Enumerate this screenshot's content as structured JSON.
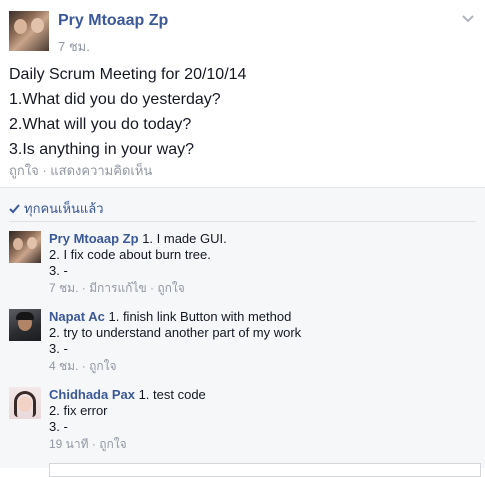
{
  "post": {
    "author": "Pry Mtoaap Zp",
    "time": "7 ชม.",
    "lines": [
      "Daily Scrum Meeting for 20/10/14",
      "1.What did you do yesterday?",
      "2.What will you do today?",
      "3.Is anything in your way?"
    ],
    "actions": {
      "like": "ถูกใจ",
      "separator": " · ",
      "comment": "แสดงความคิดเห็น"
    }
  },
  "feedback": {
    "seen_label": "ทุกคนเห็นแล้ว",
    "comments": [
      {
        "author": "Pry Mtoaap Zp",
        "line1": " 1. I made GUI.",
        "line2": "2. I fix code about burn tree.",
        "line3": "3. -",
        "time": "7 ชม.",
        "edited": "มีการแก้ไข",
        "like": "ถูกใจ"
      },
      {
        "author": "Napat Ac",
        "line1": " 1. finish link Button with method",
        "line2": "2. try to understand another part of my work",
        "line3": "3. -",
        "time": "4 ชม.",
        "like": "ถูกใจ"
      },
      {
        "author": "Chidhada Pax",
        "line1": " 1. test code",
        "line2": "2. fix error",
        "line3": "3. -",
        "time": "19 นาที",
        "like": "ถูกใจ"
      }
    ],
    "meta_separator": " · "
  },
  "colors": {
    "link": "#3b5998",
    "text": "#141823",
    "meta": "#9197a3",
    "feedback_bg": "#f6f7f9"
  },
  "icons": [
    "chevron-down-icon",
    "check-icon"
  ]
}
